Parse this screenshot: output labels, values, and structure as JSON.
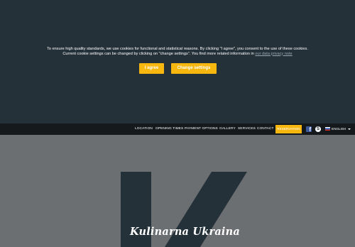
{
  "cookie": {
    "text": "To ensure high quality standards, we use cookies for functional and statistical reasons. By clicking \"I agree\", you consent to the use of these cookies. Current cookie settings can be changed by clicking on \"change settings\". You find more related information in",
    "link": "our data privacy note",
    "agree_label": "I agree",
    "settings_label": "Change settings"
  },
  "nav": {
    "items": [
      "LOCATION",
      "OPENING TIMES",
      "PAYMENT OPTIONS",
      "GALLERY",
      "SERVICES",
      "CONTACT"
    ],
    "reservation_label": "RESERVATION",
    "language_label": "ENGLISH"
  },
  "icons": {
    "facebook": "facebook-icon",
    "skype": "skype-icon",
    "flag": "uk-flag-icon",
    "caret": "chevron-down-icon"
  },
  "hero": {
    "brand": "Kulinarna Ukraina"
  },
  "colors": {
    "banner_bg": "#253139",
    "accent": "#f7b70f",
    "navbar_bg": "#15191c",
    "hero_bg": "#6c6f72",
    "logo": "#253139"
  }
}
